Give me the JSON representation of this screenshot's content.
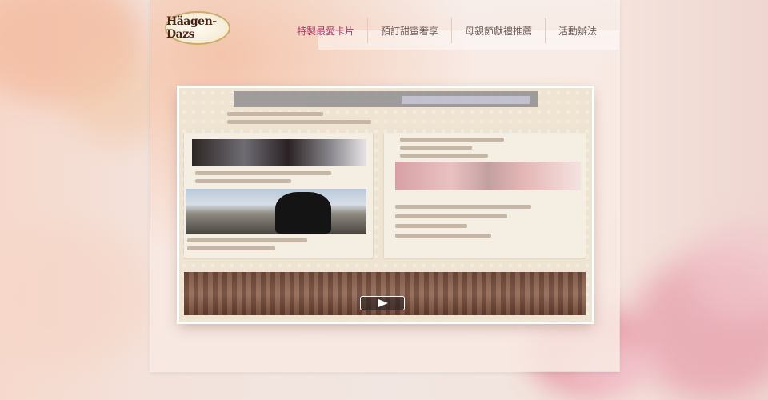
{
  "brand": {
    "logo_text": "Häagen-Dazs"
  },
  "nav": {
    "items": [
      {
        "label": "特製最愛卡片",
        "active": true
      },
      {
        "label": "預訂甜蜜奢享",
        "active": false
      },
      {
        "label": "母親節獻禮推薦",
        "active": false
      },
      {
        "label": "活動辦法",
        "active": false
      }
    ]
  },
  "colors": {
    "active_nav": "#b3396b",
    "nav_text": "#6f5d5a"
  },
  "icons": {
    "play": "play-icon"
  }
}
